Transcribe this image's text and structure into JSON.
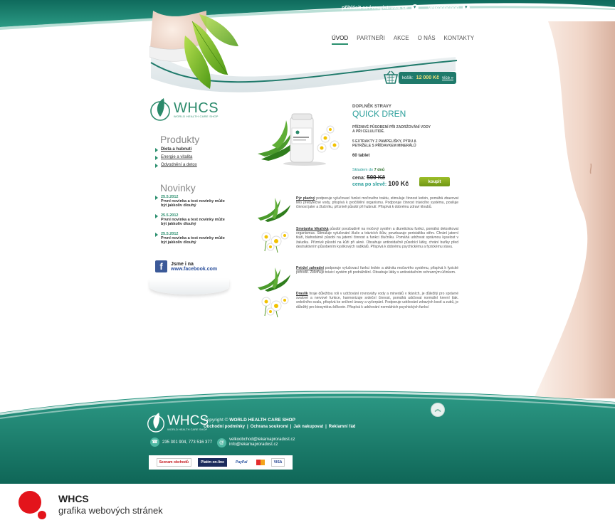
{
  "header": {
    "login_link": "přihlásit se / resgistrovat se",
    "wholesale_link": "velkoobchod",
    "nav": [
      "ÚVOD",
      "PARTNEŘI",
      "AKCE",
      "O NÁS",
      "KONTAKTY"
    ],
    "cart": {
      "label": "košík:",
      "amount": "12 000 Kč",
      "more": "více »"
    }
  },
  "logo": {
    "name": "WHCS",
    "sub": "WORLD HEALTH CARE SHOP"
  },
  "sidebar": {
    "products_title": "Produkty",
    "products": [
      "Dieta a hubnutí",
      "Energie a vitalita",
      "Odvodnění a detox"
    ],
    "news_title": "Novinky",
    "news": [
      {
        "date": "25.5.2012",
        "text": "První novinka a test novinky může být jakkoliv dlouhý"
      },
      {
        "date": "25.5.2012",
        "text": "První novinka a test novinky může být jakkoliv dlouhý"
      },
      {
        "date": "25.5.2012",
        "text": "První novinka a test novinky může být jakkoliv dlouhý"
      }
    ],
    "facebook": {
      "line1": "Jsme i na",
      "line2": "www.facebook.com"
    }
  },
  "product": {
    "category": "DOPLNĚK STRAVY",
    "name": "QUICK DREN",
    "desc1": "PŘÍZNIVÉ PŮSOBENÍ PŘI ZADRŽOVÁNÍ VODY A PŘI CELULITIDĚ.",
    "desc2": "5 EXTRAKTY Z PAMPELIŠKY, PÝRU A PETRŽELE S PŘÍDAVKEM MINERÁLŮ",
    "quantity": "60 tablet",
    "stock_label": "Skladem do",
    "stock_days": "7 dnů",
    "price_label": "cena:",
    "price_old": "500 Kč",
    "price_sale_label": "cena po slevě:",
    "price_sale": "100 Kč",
    "buy_label": "koupit"
  },
  "ingredients": [
    {
      "name": "Pýr plazivý",
      "text": " podporuje vylučovací funkci močového traktu, stimuluje činnost ledvin, pomáhá zbavovat tělo přebytečné vody, přispívá k pročištění organismu. Podporuje činnost trávicího systému, posiluje činnost jater a žlučníku, příznivě působí při hubnutí. Přispívá k dobrému zdraví kloubů."
    },
    {
      "name": "Smetanka lékařská",
      "text": " působí povzbudivě na močový systém a diuretickou funkci, pomáhá detoxikovat organismus. Stimuluje vylučování žluče a trávicích šťáv, povzbuzuje peristaltiku střev. Chrání jaterní tkáň, blahodárně působí na jaterní činnost a funkci žlučníku. Pomáhá udržovat správnou kyselost v žaludku. Příznivě působí na kůži při akné. Obsahuje antioxidačně působící látky, chrání buňky před destruktivním působením kyslíkových radikálů. Přispívá k dobrému psychickému a fyzickému stavu."
    },
    {
      "name": "Petržel zahradní",
      "text": " podporuje vylučovací funkci ledvin a aktivitu močového systému, přispívá k fyzické pohodě. Zklidňuje trávicí systém při podráždění. Obsahuje látky s antioxidačním ochranným účinkem."
    },
    {
      "name": "Draslík",
      "text": " hraje důležitou roli v udržování rovnováhy vody a minerálů v tkáních, je důležitý pro správné svalové a nervové funkce, harmonizuje srdeční činnost, pomáhá udržovat normální krevní tlak. srdečního svalu, přispívá ke snížení únavy a vyčerpání. Podporuje udržování zdravých kostí a zubů, je důležitý pro biosyntézu bílkovin. Přispívá k udržování normálních psychických funkcí"
    }
  ],
  "footer": {
    "copyright_prefix": "Copyright ©",
    "copyright_name": "WORLD HEALTH CARE SHOP",
    "links": [
      "Obchodní podmínky",
      "Ochrana soukromí",
      "Jak nakupovat",
      "Reklamní řád"
    ],
    "phone": "235 301 904, 773 516 377",
    "email1": "velkoobchod@lekarnaproradost.cz",
    "email2": "info@lekarnaproradost.cz",
    "payments": [
      "Seznam obchodů",
      "Platím on-line",
      "PayPal",
      "",
      "VISA"
    ]
  },
  "caption": {
    "title": "WHCS",
    "subtitle": "grafika webových stránek"
  },
  "colors": {
    "teal": "#1f7a6b",
    "accent": "#2a9e9a",
    "buy_green": "#8bb120",
    "brand_red": "#e3141b"
  }
}
